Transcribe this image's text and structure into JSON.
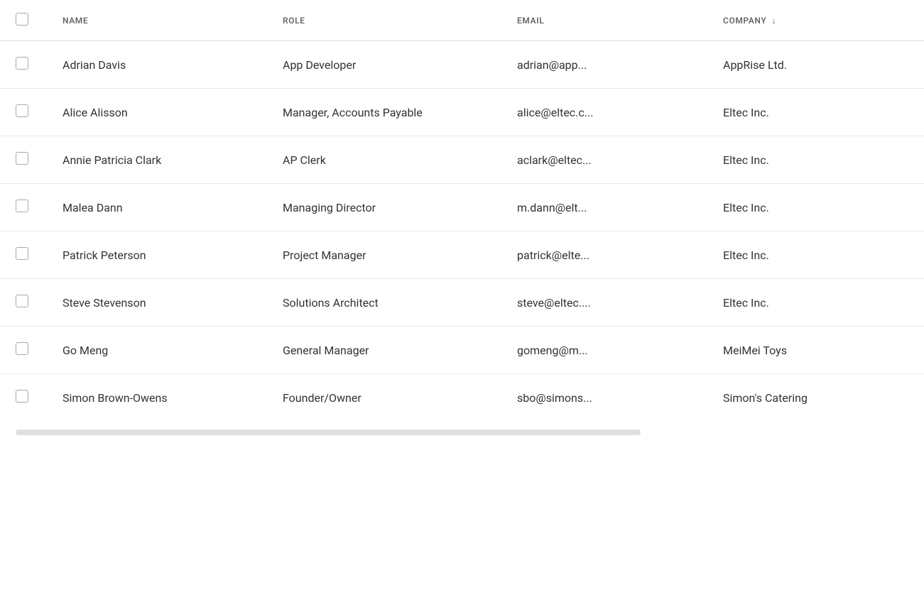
{
  "table": {
    "columns": [
      {
        "id": "check",
        "label": ""
      },
      {
        "id": "name",
        "label": "NAME"
      },
      {
        "id": "role",
        "label": "ROLE"
      },
      {
        "id": "email",
        "label": "EMAIL"
      },
      {
        "id": "company",
        "label": "COMPANY",
        "sorted": true,
        "sortDir": "desc"
      }
    ],
    "rows": [
      {
        "name": "Adrian Davis",
        "role": "App Developer",
        "email": "adrian@app...",
        "company": "AppRise Ltd."
      },
      {
        "name": "Alice Alisson",
        "role": "Manager, Accounts Payable",
        "email": "alice@eltec.c...",
        "company": "Eltec Inc."
      },
      {
        "name": "Annie Patricia Clark",
        "role": "AP Clerk",
        "email": "aclark@eltec...",
        "company": "Eltec Inc."
      },
      {
        "name": "Malea Dann",
        "role": "Managing Director",
        "email": "m.dann@elt...",
        "company": "Eltec Inc."
      },
      {
        "name": "Patrick Peterson",
        "role": "Project Manager",
        "email": "patrick@elte...",
        "company": "Eltec Inc."
      },
      {
        "name": "Steve Stevenson",
        "role": "Solutions Architect",
        "email": "steve@eltec....",
        "company": "Eltec Inc."
      },
      {
        "name": "Go Meng",
        "role": "General Manager",
        "email": "gomeng@m...",
        "company": "MeiMei Toys"
      },
      {
        "name": "Simon Brown-Owens",
        "role": "Founder/Owner",
        "email": "sbo@simons...",
        "company": "Simon's Catering"
      }
    ],
    "sort_icon": "↓"
  }
}
